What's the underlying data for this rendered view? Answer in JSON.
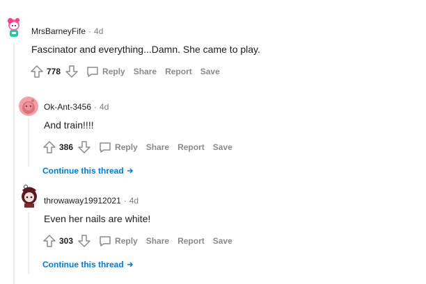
{
  "comments": [
    {
      "author": "MrsBarneyFife",
      "age": "4d",
      "body": "Fascinator and everything...Damn. She came to play.",
      "score": "778",
      "reply_label": "Reply",
      "share_label": "Share",
      "report_label": "Report",
      "save_label": "Save"
    },
    {
      "author": "Ok-Ant-3456",
      "age": "4d",
      "body": "And train!!!!",
      "score": "386",
      "reply_label": "Reply",
      "share_label": "Share",
      "report_label": "Report",
      "save_label": "Save",
      "continue_label": "Continue this thread"
    },
    {
      "author": "throwaway19912021",
      "age": "4d",
      "body": "Even her nails are white!",
      "score": "303",
      "reply_label": "Reply",
      "share_label": "Share",
      "report_label": "Report",
      "save_label": "Save",
      "continue_label": "Continue this thread"
    }
  ],
  "separator": "·",
  "colors": {
    "link_blue": "#0079d3",
    "muted": "#7c7c7c",
    "action_gray": "#878a8c",
    "thread_line": "#edeff1"
  }
}
